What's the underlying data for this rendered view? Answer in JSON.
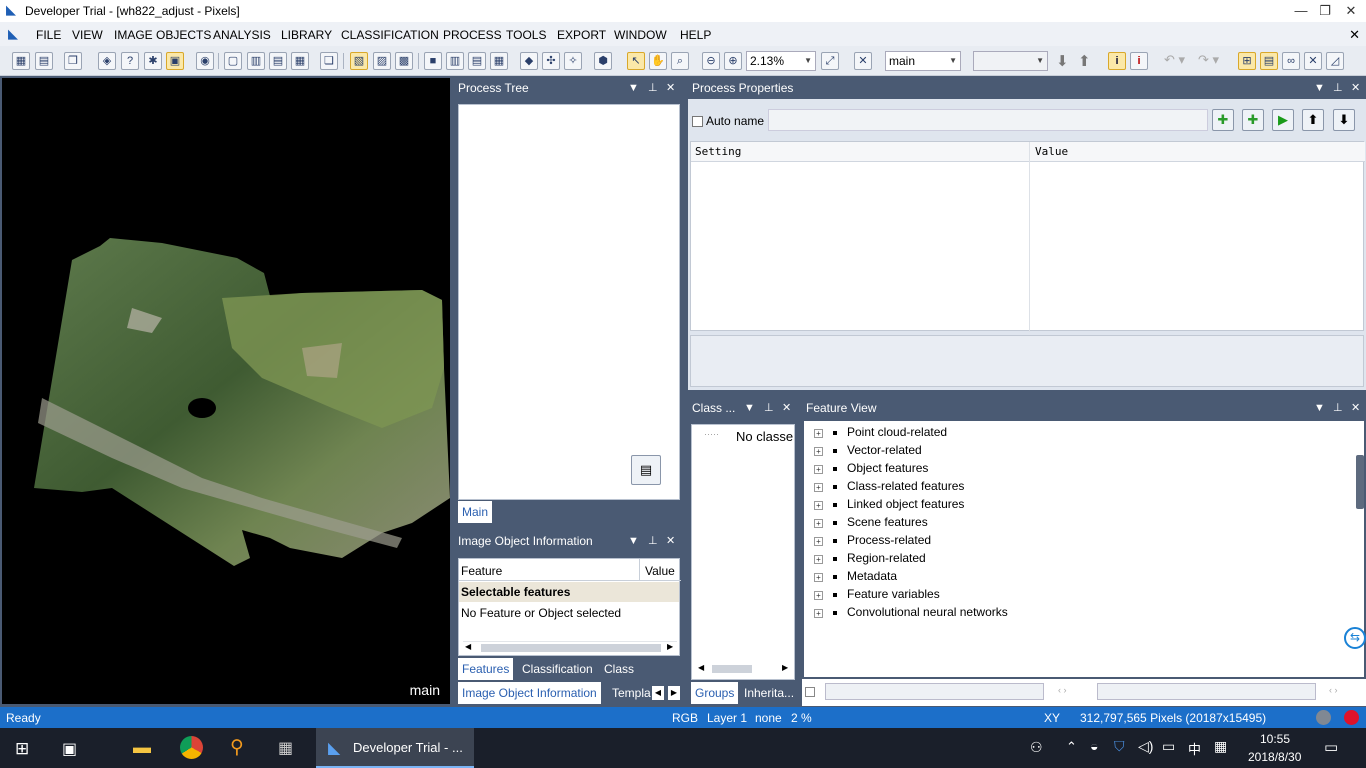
{
  "window": {
    "title": "Developer Trial - [wh822_adjust - Pixels]",
    "minimize": "—",
    "restore": "❐",
    "close": "✕"
  },
  "menu": [
    "FILE",
    "VIEW",
    "IMAGE OBJECTS",
    "ANALYSIS",
    "LIBRARY",
    "CLASSIFICATION",
    "PROCESS",
    "TOOLS",
    "EXPORT",
    "WINDOW",
    "HELP"
  ],
  "toolbar": {
    "zoom": "2.13%",
    "map_select": "main",
    "secondary_select": ""
  },
  "viewer": {
    "label": "main"
  },
  "process_tree": {
    "title": "Process Tree",
    "tab": "Main"
  },
  "image_object_info": {
    "title": "Image Object Information",
    "columns": [
      "Feature",
      "Value"
    ],
    "group": "Selectable features",
    "empty": "No Feature or Object selected",
    "tabs": [
      "Features",
      "Classification",
      "Class Evaluat..."
    ],
    "bottom_tabs": [
      "Image Object Information",
      "Templa"
    ]
  },
  "process_properties": {
    "title": "Process Properties",
    "auto_name": "Auto name",
    "columns": [
      "Setting",
      "Value"
    ]
  },
  "class_panel": {
    "title": "Class ...",
    "item": "No classe",
    "tabs": [
      "Groups",
      "Inherita..."
    ]
  },
  "feature_view": {
    "title": "Feature View",
    "items": [
      "Point cloud-related",
      "Vector-related",
      "Object features",
      "Class-related features",
      "Linked object features",
      "Scene features",
      "Process-related",
      "Region-related",
      "Metadata",
      "Feature variables",
      "Convolutional neural networks"
    ]
  },
  "status": {
    "ready": "Ready",
    "mode": "RGB",
    "layer": "Layer 1",
    "none": "none",
    "percent": "2 %",
    "xy": "XY",
    "pixels": "312,797,565 Pixels  (20187x15495)"
  },
  "taskbar": {
    "app": "Developer Trial - ...",
    "time": "10:55",
    "date": "2018/8/30",
    "ime": "中"
  }
}
